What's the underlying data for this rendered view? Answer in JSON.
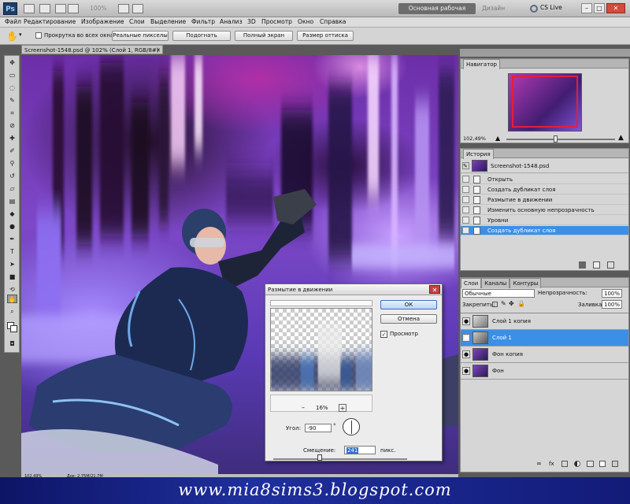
{
  "titlebar": {
    "app_badge": "Ps",
    "zoom": "100%",
    "workspace": "Основная рабочая среда",
    "design": "Дизайн",
    "cs_live": "CS Live",
    "minimize": "–",
    "maximize": "□",
    "close": "✕"
  },
  "menu": [
    "Файл",
    "Редактирование",
    "Изображение",
    "Слои",
    "Выделение",
    "Фильтр",
    "Анализ",
    "3D",
    "Просмотр",
    "Окно",
    "Справка"
  ],
  "options": {
    "scroll_all": "Прокрутка во всех окнах",
    "actual_pixels": "Реальные пикселы",
    "fit": "Подогнать",
    "full_screen": "Полный экран",
    "print_size": "Размер оттиска"
  },
  "document": {
    "tab": "Screenshot-1548.psd @ 102% (Слой 1, RGB/8#) *",
    "close": "✕"
  },
  "navigator": {
    "title": "Навигатор",
    "zoom": "102,49%"
  },
  "history": {
    "title": "История",
    "snapshot": "Screenshot-1548.psd",
    "items": [
      {
        "label": "Открыть",
        "selected": false
      },
      {
        "label": "Создать дубликат слоя",
        "selected": false
      },
      {
        "label": "Размытие в движении",
        "selected": false
      },
      {
        "label": "Изменить основную непрозрачность",
        "selected": false
      },
      {
        "label": "Уровни",
        "selected": false
      },
      {
        "label": "Создать дубликат слоя",
        "selected": true
      }
    ]
  },
  "layers": {
    "tabs": [
      "Слои",
      "Каналы",
      "Контуры"
    ],
    "blend_mode": "Обычные",
    "opacity_label": "Непрозрачность:",
    "opacity_value": "100%",
    "lock_label": "Закрепить:",
    "fill_label": "Заливка:",
    "fill_value": "100%",
    "items": [
      {
        "label": "Слой 1 копия",
        "selected": false
      },
      {
        "label": "Слой 1",
        "selected": true
      },
      {
        "label": "Фон копия",
        "selected": false
      },
      {
        "label": "Фон",
        "selected": false
      }
    ]
  },
  "dialog": {
    "title": "Размытие в движении",
    "ok": "ОК",
    "cancel": "Отмена",
    "preview_label": "Просмотр",
    "zoom_minus": "–",
    "zoom_value": "16%",
    "zoom_plus": "+",
    "angle_label": "Угол:",
    "angle_value": "-90",
    "degree": "°",
    "distance_label": "Смещение:",
    "distance_value": "241",
    "distance_unit": "пикс."
  },
  "status": {
    "zoom": "102,49%",
    "doc": "Док: 2,75M/21,7M"
  },
  "watermark": "www.mia8sims3.blogspot.com",
  "colors": {
    "selection": "#3b8fe6",
    "footer": "#1f2f9c"
  }
}
